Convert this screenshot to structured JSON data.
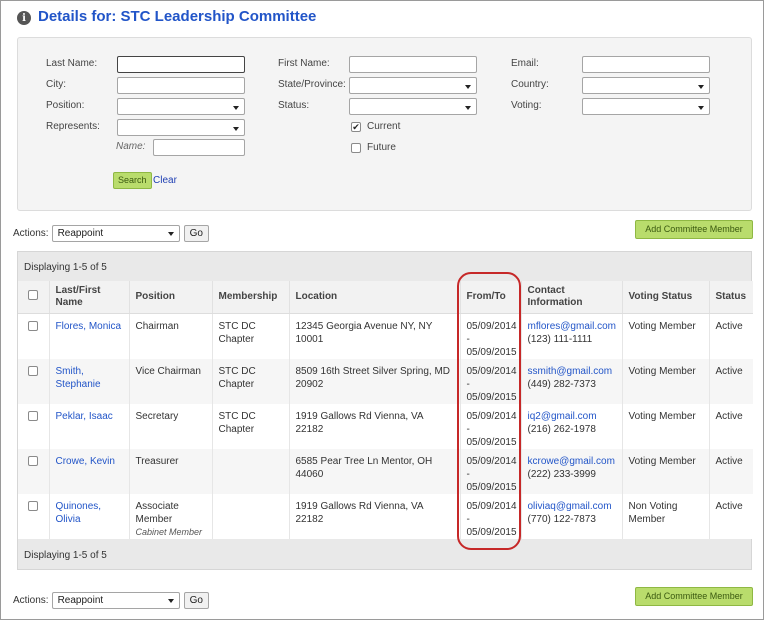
{
  "header": {
    "title": "Details for: STC Leadership Committee",
    "icon": "info-icon"
  },
  "search": {
    "last_name_label": "Last Name:",
    "first_name_label": "First Name:",
    "email_label": "Email:",
    "city_label": "City:",
    "state_label": "State/Province:",
    "country_label": "Country:",
    "position_label": "Position:",
    "status_label": "Status:",
    "voting_label": "Voting:",
    "represents_label": "Represents:",
    "name_label": "Name:",
    "current_label": "Current",
    "current_checked": true,
    "future_label": "Future",
    "future_checked": false,
    "search_button": "Search",
    "clear_link": "Clear"
  },
  "actions_top": {
    "label": "Actions:",
    "selected": "Reappoint",
    "go": "Go",
    "add": "Add Committee Member"
  },
  "actions_bottom": {
    "label": "Actions:",
    "selected": "Reappoint",
    "go": "Go",
    "add": "Add Committee Member"
  },
  "grid": {
    "display_top": "Displaying 1-5 of 5",
    "display_bottom": "Displaying 1-5 of 5",
    "columns": [
      "Last/First Name",
      "Position",
      "Membership",
      "Location",
      "From/To",
      "Contact Information",
      "Voting Status",
      "Status"
    ],
    "rows": [
      {
        "name": "Flores, Monica",
        "position": "Chairman",
        "position_sub": "",
        "membership": "STC DC Chapter",
        "location": "12345 Georgia Avenue NY, NY 10001",
        "from": "05/09/2014",
        "sep": "-",
        "to": "05/09/2015",
        "email": "mflores@gmail.com",
        "phone": "(123) 111-1111",
        "voting": "Voting Member",
        "status": "Active"
      },
      {
        "name": "Smith, Stephanie",
        "position": "Vice Chairman",
        "position_sub": "",
        "membership": "STC DC Chapter",
        "location": "8509 16th Street Silver Spring, MD 20902",
        "from": "05/09/2014",
        "sep": "-",
        "to": "05/09/2015",
        "email": "ssmith@gmail.com",
        "phone": "(449) 282-7373",
        "voting": "Voting Member",
        "status": "Active"
      },
      {
        "name": "Peklar, Isaac",
        "position": "Secretary",
        "position_sub": "",
        "membership": "STC DC Chapter",
        "location": "1919 Gallows Rd Vienna, VA 22182",
        "from": "05/09/2014",
        "sep": "-",
        "to": "05/09/2015",
        "email": "iq2@gmail.com",
        "phone": "(216) 262-1978",
        "voting": "Voting Member",
        "status": "Active"
      },
      {
        "name": "Crowe, Kevin",
        "position": "Treasurer",
        "position_sub": "",
        "membership": "",
        "location": "6585 Pear Tree Ln Mentor, OH 44060",
        "from": "05/09/2014",
        "sep": "-",
        "to": "05/09/2015",
        "email": "kcrowe@gmail.com",
        "phone": "(222) 233-3999",
        "voting": "Voting Member",
        "status": "Active"
      },
      {
        "name": "Quinones, Olivia",
        "position": "Associate Member",
        "position_sub": "Cabinet Member",
        "membership": "",
        "location": "1919 Gallows Rd Vienna, VA 22182",
        "from": "05/09/2014",
        "sep": "-",
        "to": "05/09/2015",
        "email": "oliviaq@gmail.com",
        "phone": "(770) 122-7873",
        "voting": "Non Voting Member",
        "status": "Active"
      }
    ]
  },
  "colors": {
    "title": "#2255c8",
    "link": "#2255c8",
    "green_button": "#b9dc6c",
    "highlight": "#c62828"
  }
}
